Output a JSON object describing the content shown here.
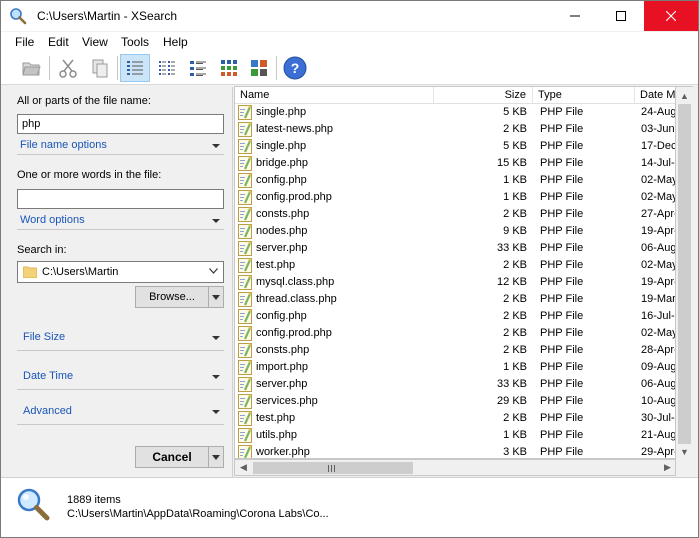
{
  "window": {
    "title": "C:\\Users\\Martin - XSearch",
    "accent_close": "#e81123"
  },
  "menu": [
    "File",
    "Edit",
    "View",
    "Tools",
    "Help"
  ],
  "toolbar": {
    "icons": [
      "open-folder-icon",
      "cut-icon",
      "copy-icon",
      "details-view-icon",
      "list-view-icon",
      "small-icons-view-icon",
      "large-icons-view-icon",
      "tiles-view-icon",
      "help-icon"
    ]
  },
  "search": {
    "file_name_label": "All or parts of the file name:",
    "file_name_value": "php",
    "file_name_options": "File name options",
    "words_label": "One or more words in the file:",
    "words_value": "",
    "word_options": "Word options",
    "search_in_label": "Search in:",
    "search_in_value": "C:\\Users\\Martin",
    "browse_label": "Browse...",
    "file_size_label": "File Size",
    "date_time_label": "Date Time",
    "advanced_label": "Advanced",
    "cancel_label": "Cancel"
  },
  "columns": {
    "name": "Name",
    "size": "Size",
    "type": "Type",
    "date": "Date M"
  },
  "rows": [
    {
      "name": "single.php",
      "size": "5 KB",
      "type": "PHP File",
      "date": "24-Aug"
    },
    {
      "name": "latest-news.php",
      "size": "2 KB",
      "type": "PHP File",
      "date": "03-Jun-"
    },
    {
      "name": "single.php",
      "size": "5 KB",
      "type": "PHP File",
      "date": "17-Dec"
    },
    {
      "name": "bridge.php",
      "size": "15 KB",
      "type": "PHP File",
      "date": "14-Jul-"
    },
    {
      "name": "config.php",
      "size": "1 KB",
      "type": "PHP File",
      "date": "02-May"
    },
    {
      "name": "config.prod.php",
      "size": "1 KB",
      "type": "PHP File",
      "date": "02-May"
    },
    {
      "name": "consts.php",
      "size": "2 KB",
      "type": "PHP File",
      "date": "27-Apr-"
    },
    {
      "name": "nodes.php",
      "size": "9 KB",
      "type": "PHP File",
      "date": "19-Apr-"
    },
    {
      "name": "server.php",
      "size": "33 KB",
      "type": "PHP File",
      "date": "06-Aug"
    },
    {
      "name": "test.php",
      "size": "2 KB",
      "type": "PHP File",
      "date": "02-May"
    },
    {
      "name": "mysql.class.php",
      "size": "12 KB",
      "type": "PHP File",
      "date": "19-Apr-"
    },
    {
      "name": "thread.class.php",
      "size": "2 KB",
      "type": "PHP File",
      "date": "19-Mar-"
    },
    {
      "name": "config.php",
      "size": "2 KB",
      "type": "PHP File",
      "date": "16-Jul-"
    },
    {
      "name": "config.prod.php",
      "size": "2 KB",
      "type": "PHP File",
      "date": "02-May"
    },
    {
      "name": "consts.php",
      "size": "2 KB",
      "type": "PHP File",
      "date": "28-Apr-"
    },
    {
      "name": "import.php",
      "size": "1 KB",
      "type": "PHP File",
      "date": "09-Aug"
    },
    {
      "name": "server.php",
      "size": "33 KB",
      "type": "PHP File",
      "date": "06-Aug"
    },
    {
      "name": "services.php",
      "size": "29 KB",
      "type": "PHP File",
      "date": "10-Aug"
    },
    {
      "name": "test.php",
      "size": "2 KB",
      "type": "PHP File",
      "date": "30-Jul-"
    },
    {
      "name": "utils.php",
      "size": "1 KB",
      "type": "PHP File",
      "date": "21-Aug"
    },
    {
      "name": "worker.php",
      "size": "3 KB",
      "type": "PHP File",
      "date": "29-Apr-"
    }
  ],
  "status": {
    "count": "1889 items",
    "path": "C:\\Users\\Martin\\AppData\\Roaming\\Corona Labs\\Co..."
  }
}
